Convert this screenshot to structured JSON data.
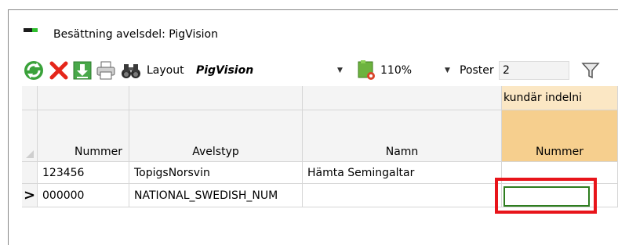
{
  "window": {
    "title": "Besättning avelsdel: PigVision",
    "title_mark_colors": [
      "#1c1c1c",
      "#2fbf2f"
    ]
  },
  "toolbar": {
    "icons": [
      "refresh-icon",
      "delete-icon",
      "download-icon",
      "print-icon",
      "binoculars-icon",
      "layout-settings-icon",
      "filter-icon"
    ],
    "layout_label": "Layout",
    "layout_value": "PigVision",
    "zoom_value": "110%",
    "poster_label": "Poster",
    "poster_value": "2"
  },
  "grid": {
    "group_header": "kundär indelni",
    "columns": [
      "Nummer",
      "Avelstyp",
      "Namn",
      "Nummer"
    ],
    "rows": [
      {
        "indicator": "",
        "cells": [
          "123456",
          "TopigsNorsvin",
          "Hämta Semingaltar",
          ""
        ]
      },
      {
        "indicator": ">",
        "cells": [
          "000000",
          "NATIONAL_SWEDISH_NUM",
          "",
          ""
        ]
      }
    ],
    "colors": {
      "edit_border": "#2e7d1f",
      "highlight": "#e8141a",
      "header_orange": "#f6cf8e"
    }
  }
}
